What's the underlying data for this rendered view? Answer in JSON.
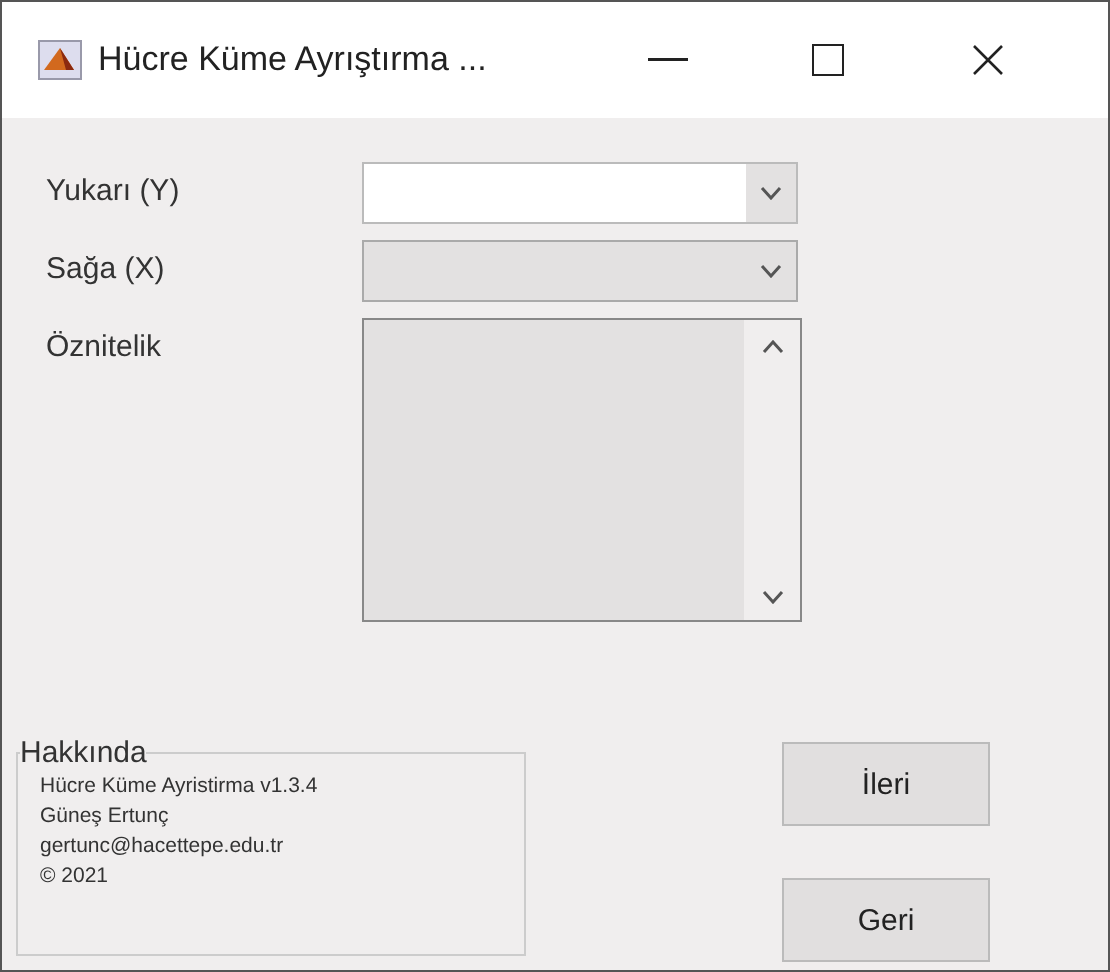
{
  "window": {
    "title": "Hücre Küme Ayrıştırma ..."
  },
  "fields": [
    {
      "label": "Yukarı (Y)",
      "kind": "dropdown",
      "disabled": false
    },
    {
      "label": "Sağa (X)",
      "kind": "dropdown",
      "disabled": true
    },
    {
      "label": "Öznitelik",
      "kind": "listbox",
      "disabled": true
    }
  ],
  "about": {
    "title": "Hakkında",
    "lines": [
      "Hücre Küme Ayristirma v1.3.4",
      "Güneş Ertunç",
      "gertunc@hacettepe.edu.tr",
      "© 2021"
    ]
  },
  "buttons": [
    "İleri",
    "Geri"
  ]
}
